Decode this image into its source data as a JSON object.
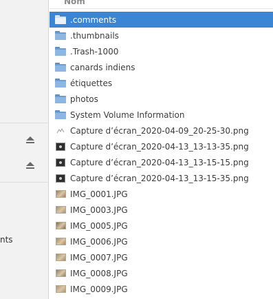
{
  "header": {
    "column_name": "Nom"
  },
  "sidebar": {
    "partial_text": "nts"
  },
  "files": [
    {
      "name": ".comments",
      "kind": "folder",
      "selected": true
    },
    {
      "name": ".thumbnails",
      "kind": "folder"
    },
    {
      "name": ".Trash-1000",
      "kind": "folder"
    },
    {
      "name": "canards indiens",
      "kind": "folder"
    },
    {
      "name": "étiquettes",
      "kind": "folder"
    },
    {
      "name": "photos",
      "kind": "folder"
    },
    {
      "name": "System Volume Information",
      "kind": "folder"
    },
    {
      "name": "Capture d’écran_2020-04-09_20-25-30.png",
      "kind": "sketch-image"
    },
    {
      "name": "Capture d’écran_2020-04-13_13-13-35.png",
      "kind": "screenshot"
    },
    {
      "name": "Capture d’écran_2020-04-13_13-15-15.png",
      "kind": "screenshot"
    },
    {
      "name": "Capture d’écran_2020-04-13_13-15-35.png",
      "kind": "screenshot"
    },
    {
      "name": "IMG_0001.JPG",
      "kind": "photo"
    },
    {
      "name": "IMG_0003.JPG",
      "kind": "photo"
    },
    {
      "name": "IMG_0005.JPG",
      "kind": "photo"
    },
    {
      "name": "IMG_0006.JPG",
      "kind": "photo"
    },
    {
      "name": "IMG_0007.JPG",
      "kind": "photo"
    },
    {
      "name": "IMG_0008.JPG",
      "kind": "photo"
    },
    {
      "name": "IMG_0009.JPG",
      "kind": "photo"
    }
  ],
  "colors": {
    "selection": "#3a86d4",
    "folder": "#8db6e3"
  }
}
